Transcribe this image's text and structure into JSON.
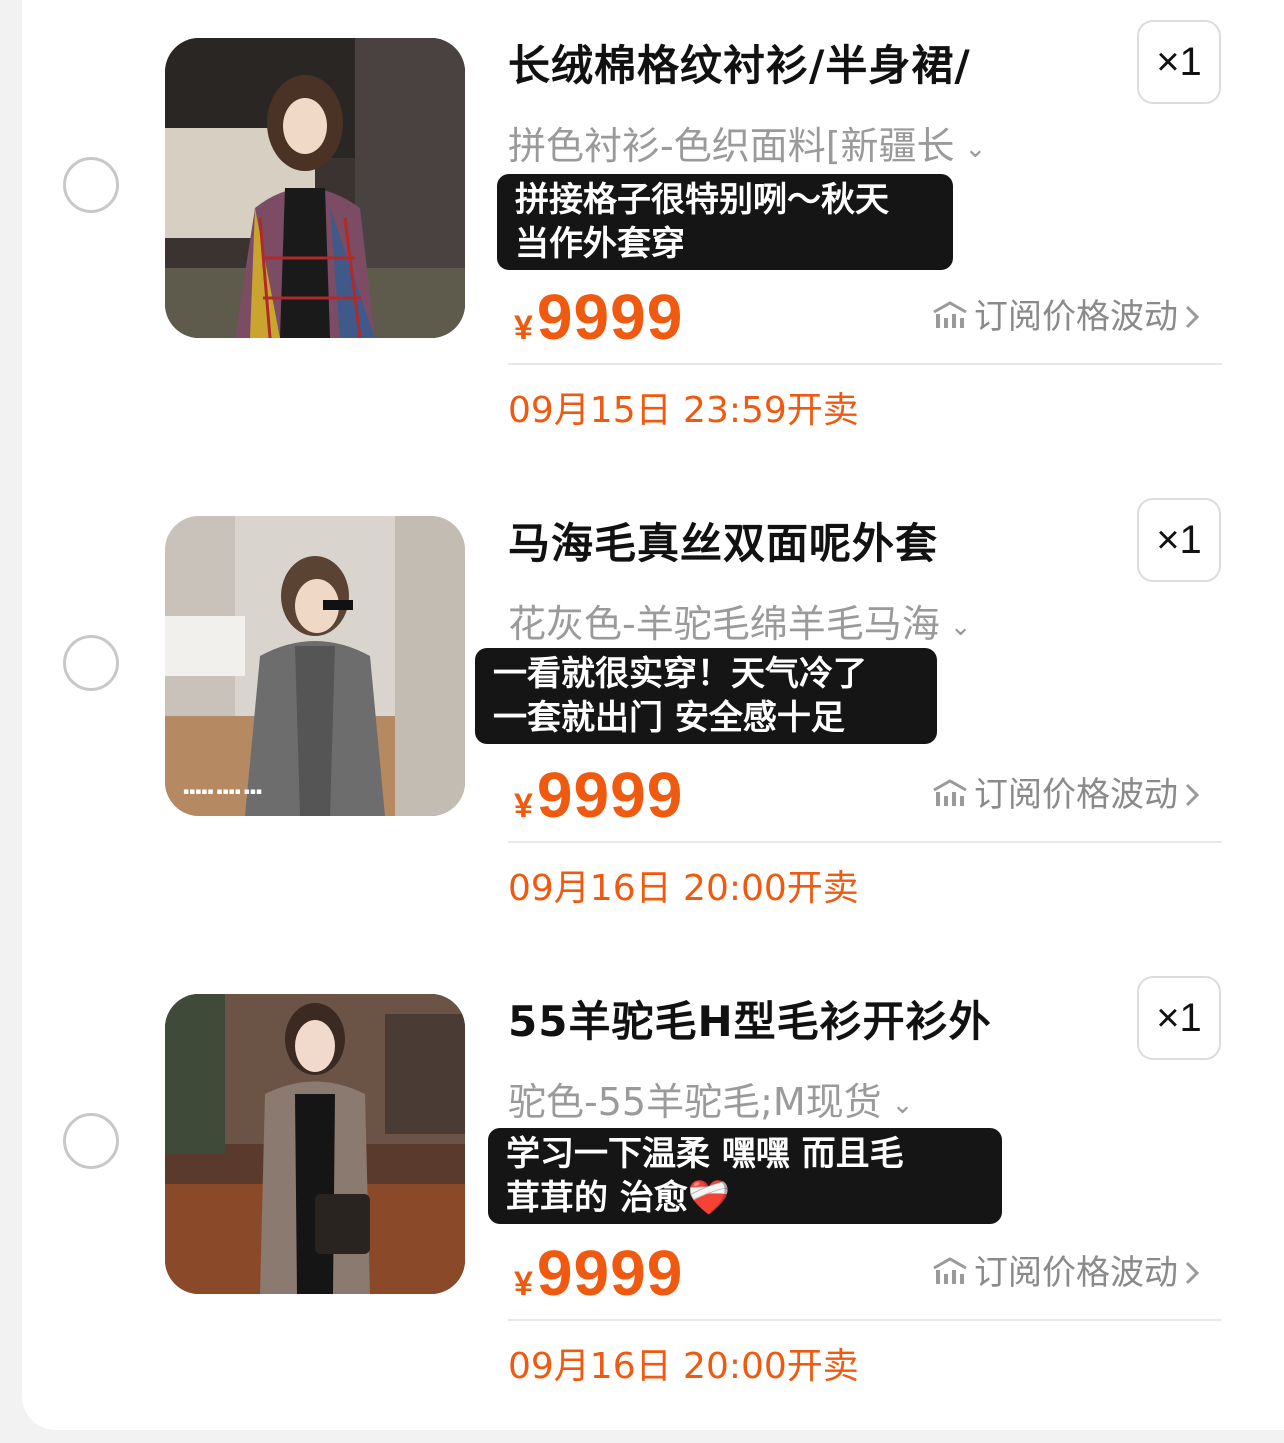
{
  "items": [
    {
      "title": "长绒棉格纹衬衫/半身裙/",
      "quantity": "×1",
      "spec": "拼色衬衫-色织面料[新疆长",
      "comment_line1": "拼接格子很特别咧～秋天",
      "comment_line2": "当作外套穿",
      "currency": "¥",
      "price": "9999",
      "subscribe_label": "订阅价格波动",
      "sale_time": "09月15日 23:59开卖"
    },
    {
      "title": "马海毛真丝双面呢外套",
      "quantity": "×1",
      "spec": "花灰色-羊驼毛绵羊毛马海",
      "comment_line1": "一看就很实穿！天气冷了",
      "comment_line2": "一套就出门 安全感十足",
      "currency": "¥",
      "price": "9999",
      "subscribe_label": "订阅价格波动",
      "sale_time": "09月16日 20:00开卖"
    },
    {
      "title": "55羊驼毛H型毛衫开衫外",
      "quantity": "×1",
      "spec": "驼色-55羊驼毛;M现货",
      "comment_line1": "学习一下温柔 嘿嘿 而且毛",
      "comment_line2": "茸茸的 治愈❤️‍🩹",
      "currency": "¥",
      "price": "9999",
      "subscribe_label": "订阅价格波动",
      "sale_time": "09月16日 20:00开卖"
    }
  ],
  "colors": {
    "accent": "#f05a10",
    "muted": "#9a9a9a",
    "bubble": "#151515"
  }
}
